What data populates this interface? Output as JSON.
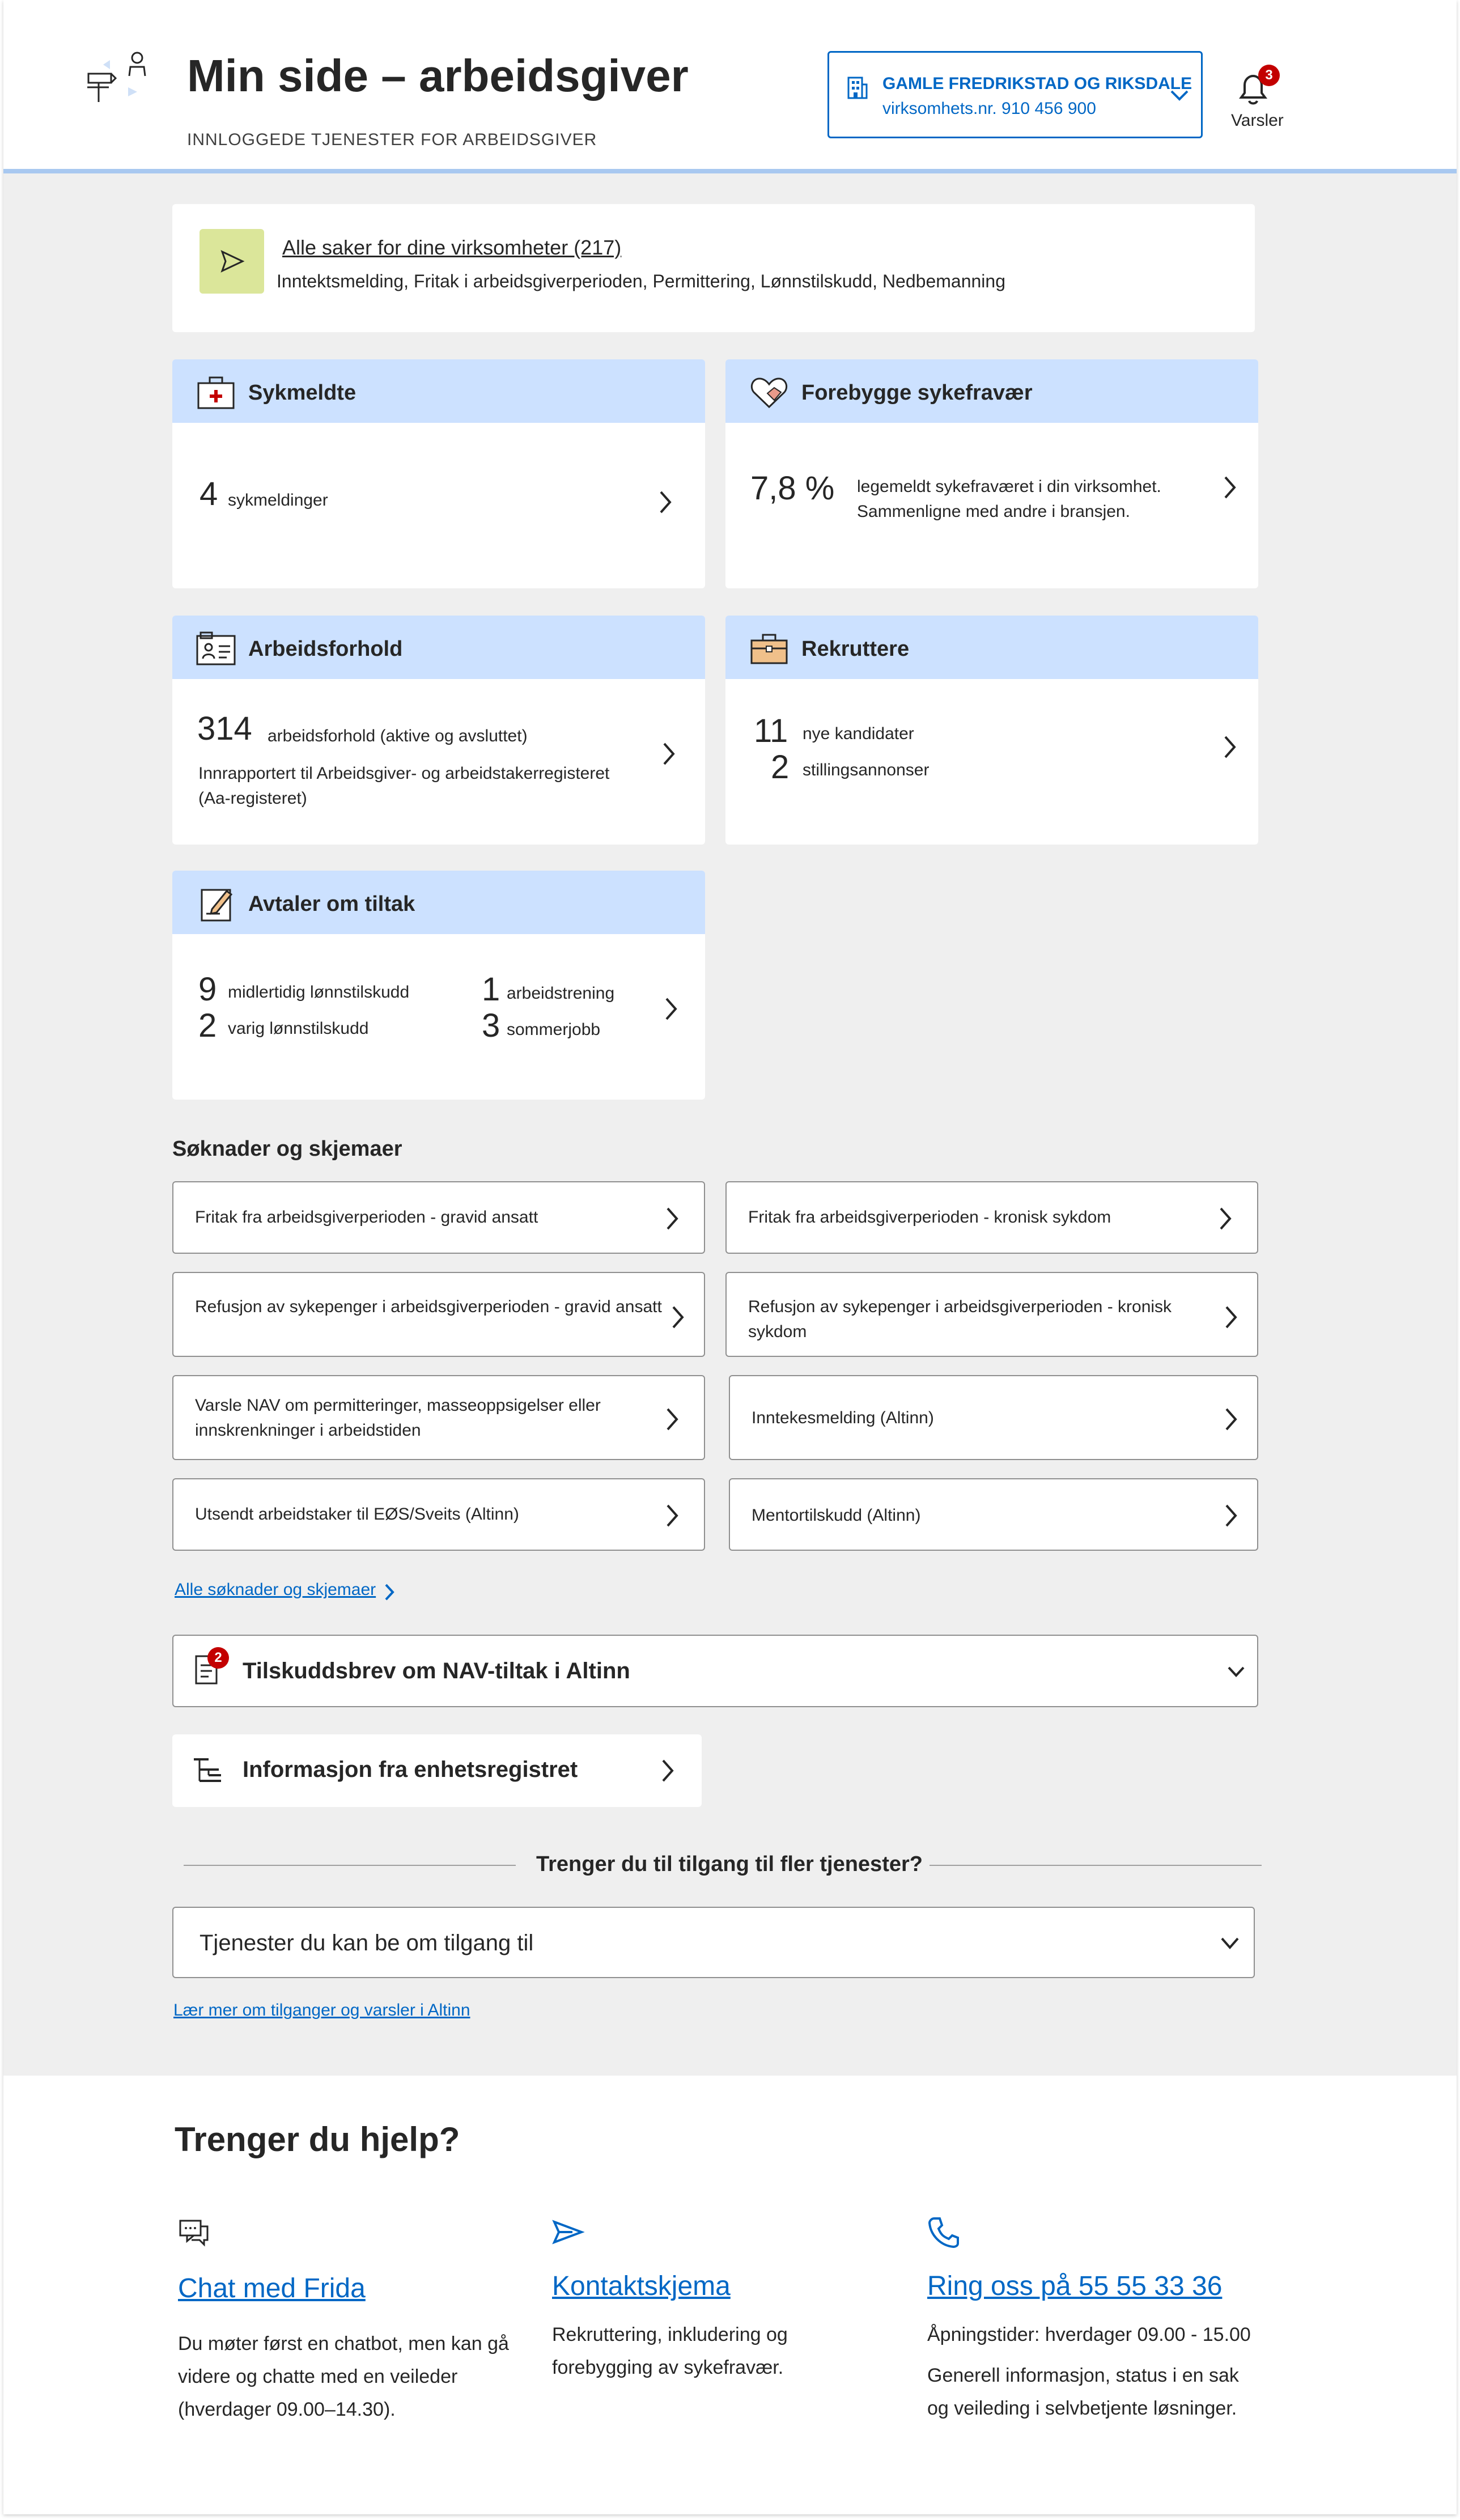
{
  "header": {
    "title": "Min side – arbeidsgiver",
    "subtitle": "INNLOGGEDE TJENESTER FOR ARBEIDSGIVER",
    "org_name": "GAMLE FREDRIKSTAD OG RIKSDALE",
    "org_nr": "virksomhets.nr. 910 456 900",
    "notifications_count": "3",
    "notifications_label": "Varsler"
  },
  "saker": {
    "link": "Alle saker for dine virksomheter (217)",
    "description": "Inntektsmelding, Fritak i arbeidsgiverperioden, Permittering, Lønnstilskudd, Nedbemanning"
  },
  "tiles": {
    "sykmeldte": {
      "title": "Sykmeldte",
      "count": "4",
      "label": "sykmeldinger"
    },
    "forebygge": {
      "title": "Forebygge sykefravær",
      "percent": "7,8 %",
      "line1": "legemeldt sykefraværet i din virksomhet.",
      "line2": "Sammenligne med andre i bransjen."
    },
    "arbeidsforhold": {
      "title": "Arbeidsforhold",
      "count": "314",
      "label": "arbeidsforhold (aktive og avsluttet)",
      "desc1": "Innrapportert til Arbeidsgiver- og arbeidstakerregisteret",
      "desc2": "(Aa-registeret)"
    },
    "rekruttere": {
      "title": "Rekruttere",
      "count1": "11",
      "label1": "nye kandidater",
      "count2": "2",
      "label2": "stillingsannonser"
    },
    "tiltak": {
      "title": "Avtaler om tiltak",
      "items": [
        {
          "count": "9",
          "label": "midlertidig lønnstilskudd"
        },
        {
          "count": "2",
          "label": "varig lønnstilskudd"
        },
        {
          "count": "1",
          "label": "arbeidstrening"
        },
        {
          "count": "3",
          "label": "sommerjobb"
        }
      ]
    }
  },
  "forms": {
    "title": "Søknader og skjemaer",
    "items": [
      {
        "line1": "Fritak fra arbeidsgiverperioden  - gravid ansatt",
        "line2": ""
      },
      {
        "line1": "Fritak fra arbeidsgiverperioden - kronisk sykdom",
        "line2": ""
      },
      {
        "line1": "Refusjon av sykepenger i arbeidsgiverperioden - gravid ansatt",
        "line2": ""
      },
      {
        "line1": "Refusjon av sykepenger i arbeidsgiverperioden -  kronisk",
        "line2": "sykdom"
      },
      {
        "line1": "Varsle NAV om permitteringer, masseoppsigelser eller",
        "line2": "innskrenkninger i arbeidstiden"
      },
      {
        "line1": "Inntekesmelding (Altinn)",
        "line2": ""
      },
      {
        "line1": "Utsendt arbeidstaker til EØS/Sveits (Altinn)",
        "line2": ""
      },
      {
        "line1": "Mentortilskudd (Altinn)",
        "line2": ""
      }
    ],
    "all_link": "Alle søknader og skjemaer"
  },
  "tilskuddsbrev": {
    "label": "Tilskuddsbrev om NAV-tiltak i Altinn",
    "badge": "2"
  },
  "enhetsregister": {
    "label": "Informasjon fra enhetsregistret"
  },
  "access": {
    "divider": "Trenger du til tilgang til fler tjenester?",
    "dropdown": "Tjenester du kan be om tilgang til",
    "link": "Lær mer om tilganger og varsler i Altinn"
  },
  "help": {
    "title": "Trenger du hjelp?",
    "chat": {
      "link": "Chat med Frida",
      "text1": "Du møter først en chatbot, men kan gå",
      "text2": "videre og chatte med en veileder",
      "text3": "(hverdager 09.00–14.30)."
    },
    "contact": {
      "link": "Kontaktskjema",
      "text1": "Rekruttering, inkludering og",
      "text2": "forebygging av sykefravær."
    },
    "phone": {
      "link": "Ring oss på 55 55 33 36",
      "text1": "Åpningstider: hverdager 09.00 - 15.00",
      "text2": "Generell informasjon, status i en sak",
      "text3": "og veileding i selvbetjente løsninger."
    }
  },
  "colors": {
    "accent": "#0067c5",
    "tile_header": "#cce1ff",
    "badge": "#c30000",
    "saker_icon_bg": "#dbe69a",
    "background": "#efefef"
  }
}
